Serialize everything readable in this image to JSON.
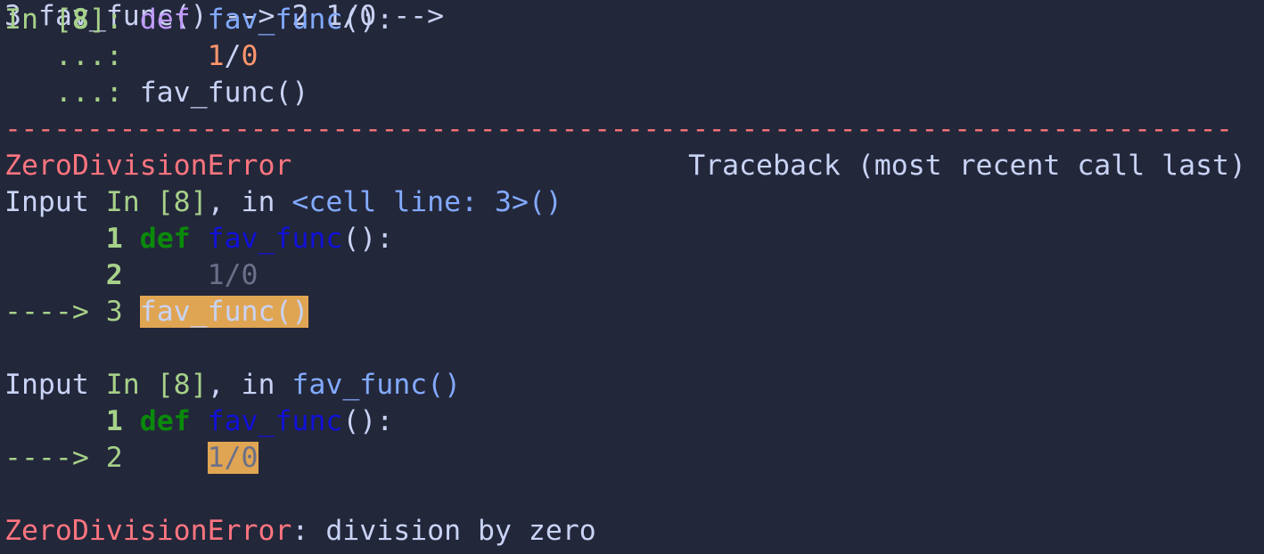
{
  "prompt": {
    "in_label": "In [",
    "cell_num": "8",
    "in_close": "]: ",
    "cont": "   ...: ",
    "kw_def": "def",
    "func_name": "fav_func",
    "paren_colon": "():",
    "indent": "    ",
    "expr_num1": "1",
    "expr_slash": "/",
    "expr_num2": "0",
    "call": "fav_func()"
  },
  "traceback": {
    "separator": "---------------------------------------------------------------------------",
    "error_name": "ZeroDivisionError",
    "header_right": "Traceback (most recent call last)",
    "frame1": {
      "prefix": "Input ",
      "in_ref": "In [8]",
      "mid": ", in ",
      "location": "<cell line: 3>()",
      "line1_no": "1",
      "line1_kw": "def",
      "line1_fn": "fav_func",
      "line1_rest": "():",
      "line2_no": "2",
      "line2_code": "1/0",
      "arrow": "---->",
      "line3_no": "3",
      "line3_code": "fav_func()"
    },
    "frame2": {
      "prefix": "Input ",
      "in_ref": "In [8]",
      "mid": ", in ",
      "location": "fav_func()",
      "line1_no": "1",
      "line1_kw": "def",
      "line1_fn": "fav_func",
      "line1_rest": "():",
      "arrow": "---->",
      "line2_no": "2",
      "line2_code": "1/0"
    },
    "final_error_name": "ZeroDivisionError",
    "final_message": ": division by zero"
  },
  "colors": {
    "background": "#23273a",
    "error": "#ff757f",
    "keyword": "#c099ff",
    "function": "#82aaff",
    "highlight": "#e0a553"
  }
}
